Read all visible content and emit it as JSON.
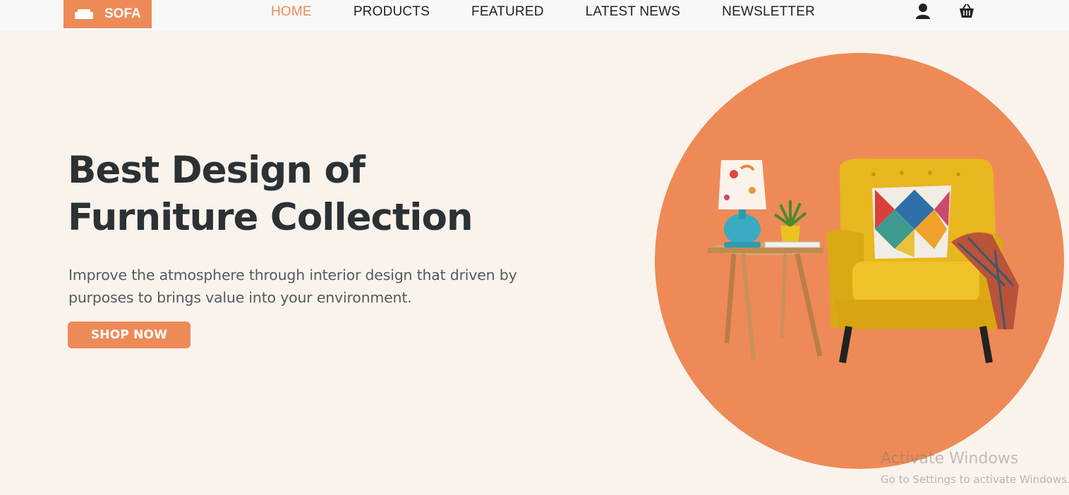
{
  "header": {
    "logo_text": "SOFA",
    "nav": [
      {
        "label": "HOME",
        "active": true
      },
      {
        "label": "PRODUCTS",
        "active": false
      },
      {
        "label": "FEATURED",
        "active": false
      },
      {
        "label": "LATEST NEWS",
        "active": false
      },
      {
        "label": "NEWSLETTER",
        "active": false
      }
    ],
    "icons": [
      "user-icon",
      "cart-icon"
    ]
  },
  "hero": {
    "title_line1": "Best Design of",
    "title_line2": "Furniture Collection",
    "description": "Improve the atmosphere through interior design that driven by purposes to brings value into your environment.",
    "button_label": "SHOP NOW"
  },
  "watermark": {
    "title": "Activate Windows",
    "subtitle": "Go to Settings to activate Windows."
  },
  "colors": {
    "accent": "#ee8a57",
    "background": "#faf3ec",
    "heading": "#2c3134",
    "chair": "#e8b61e"
  }
}
